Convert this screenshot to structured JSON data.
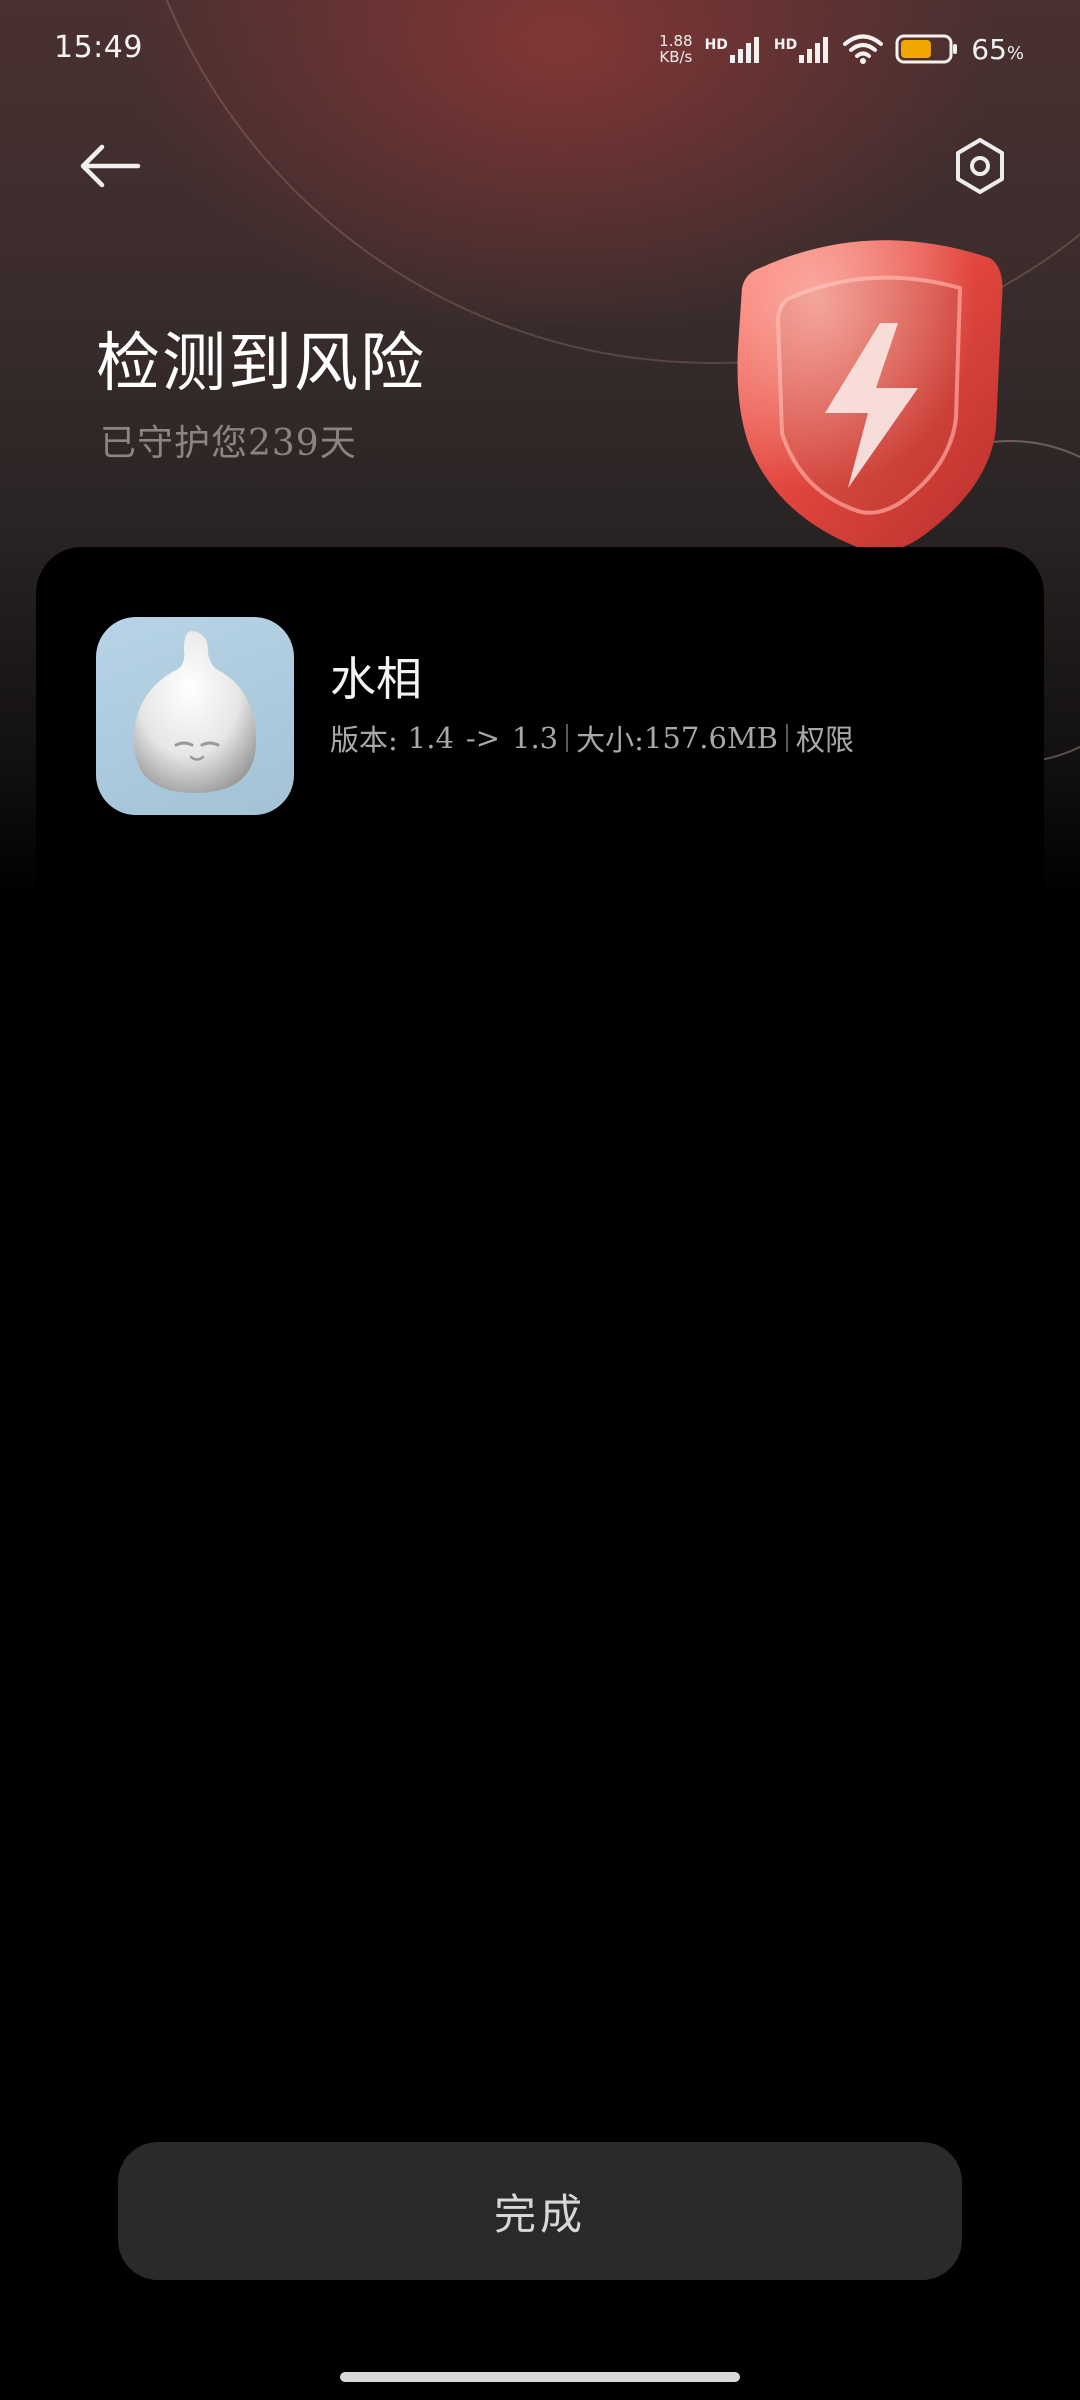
{
  "status_bar": {
    "time": "15:49",
    "net_speed_value": "1.88",
    "net_speed_unit": "KB/s",
    "sim1_label": "HD",
    "sim2_label": "HD",
    "battery_level": 0.65,
    "battery_percent": "65",
    "battery_percent_sign": "%",
    "battery_color": "#f0a800",
    "icons": [
      "signal-icon",
      "signal-icon",
      "wifi-icon",
      "battery-icon"
    ]
  },
  "nav": {
    "back_icon": "arrow-left-icon",
    "settings_icon": "hexagon-settings-icon"
  },
  "header": {
    "title": "检测到风险",
    "subtitle": "已守护您239天",
    "illustration": "shield-lightning-icon",
    "accent_color": "#e0453e"
  },
  "risk_app": {
    "name": "水相",
    "version_label": "版本:",
    "version_from": "1.4",
    "version_arrow": "->",
    "version_to": "1.3",
    "size_label": "大小:",
    "size_value": "157.6MB",
    "permissions_label": "权限",
    "icon": "water-drop-face-icon"
  },
  "footer": {
    "done_label": "完成"
  }
}
